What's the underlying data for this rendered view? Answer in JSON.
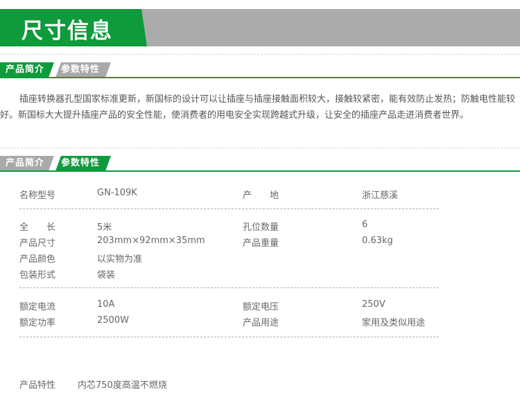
{
  "header": {
    "title": "尺寸信息"
  },
  "tabs_top": [
    {
      "label": "产品简介"
    },
    {
      "label": "参数特性"
    }
  ],
  "intro": "插座转换器孔型国家标准更新，新国标的设计可以让插座与插座接触面积较大，接触较紧密，能有效防止发热；防触电性能较好。新国标大大提升插座产品的安全性能，使消费者的用电安全实现跨越式升级，让安全的插座产品走进消费者世界。",
  "tabs_bottom": [
    {
      "label": "产品简介"
    },
    {
      "label": "参数特性"
    }
  ],
  "specs": {
    "model_label": "名称型号",
    "model_value": "GN-109K",
    "origin_label": "产　　地",
    "origin_value": "浙江慈溪",
    "length_label": "全　　长",
    "length_value": "5米",
    "holes_label": "孔位数量",
    "holes_value": "6",
    "size_label": "产品尺寸",
    "size_value": "203mm×92mm×35mm",
    "weight_label": "产品重量",
    "weight_value": "0.63kg",
    "color_label": "产品颜色",
    "color_value": "以实物为准",
    "pack_label": "包装形式",
    "pack_value": "袋装",
    "current_label": "额定电流",
    "current_value": "10A",
    "voltage_label": "额定电压",
    "voltage_value": "250V",
    "power_label": "额定功率",
    "power_value": "2500W",
    "use_label": "产品用途",
    "use_value": "家用及类似用途",
    "feature_label": "产品特性",
    "feature_value": "内芯750度高温不燃烧"
  },
  "colors": {
    "green": "#0f9a3c",
    "gray": "#a9a9a9"
  }
}
